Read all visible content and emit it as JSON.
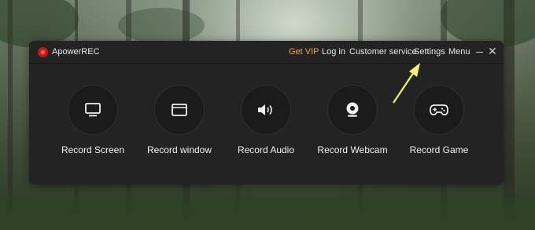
{
  "app": {
    "title": "ApowerREC"
  },
  "nav": {
    "get_vip": "Get VIP",
    "login": "Log in",
    "customer_service": "Customer service",
    "settings": "Settings",
    "menu": "Menu"
  },
  "features": [
    {
      "label": "Record Screen",
      "icon": "monitor-icon"
    },
    {
      "label": "Record window",
      "icon": "window-icon"
    },
    {
      "label": "Record Audio",
      "icon": "speaker-icon"
    },
    {
      "label": "Record Webcam",
      "icon": "webcam-icon"
    },
    {
      "label": "Record Game",
      "icon": "gamepad-icon"
    }
  ],
  "colors": {
    "vip_accent": "#f0a43a",
    "logo_red": "#e02626",
    "window_bg": "#232323",
    "arrow": "#f4f26a"
  }
}
